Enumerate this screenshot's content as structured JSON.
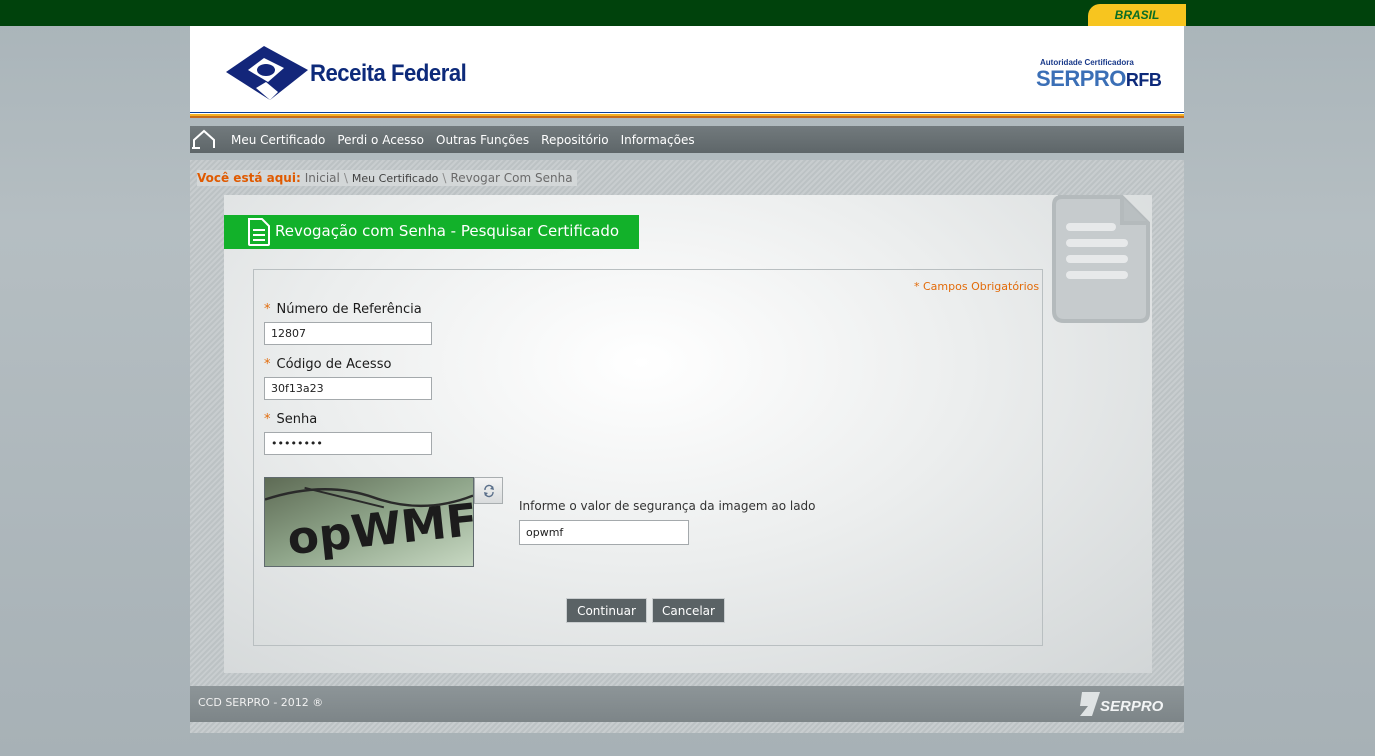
{
  "gov_bar": {
    "brand": "BRASIL"
  },
  "header": {
    "logo_text": "Receita Federal",
    "authority_small": "Autoridade Certificadora",
    "authority_brand": "SERPRO",
    "authority_suffix": "RFB"
  },
  "nav": {
    "items": [
      {
        "label": "Meu Certificado"
      },
      {
        "label": "Perdi o Acesso"
      },
      {
        "label": "Outras Funções"
      },
      {
        "label": "Repositório"
      },
      {
        "label": "Informações"
      }
    ]
  },
  "breadcrumb": {
    "label": "Você está aqui:",
    "items": [
      "Inicial",
      "Meu Certificado",
      "Revogar Com Senha"
    ],
    "separator": "\\"
  },
  "page": {
    "title": "Revogação com Senha - Pesquisar Certificado",
    "required_note": "* Campos Obrigatórios"
  },
  "form": {
    "required_mark": "*",
    "reference": {
      "label": "Número de Referência",
      "value": "12807"
    },
    "access_code": {
      "label": "Código de Acesso",
      "value": "30f13a23"
    },
    "password": {
      "label": "Senha",
      "value": "password"
    },
    "captcha": {
      "image_text": "opWMF",
      "label": "Informe o valor de segurança da imagem ao lado",
      "value": "opwmf"
    },
    "continue_label": "Continuar",
    "cancel_label": "Cancelar"
  },
  "footer": {
    "copyright": "CCD SERPRO - 2012 ®",
    "brand": "SERPRO"
  },
  "colors": {
    "gov_green": "#00420c",
    "brasil_yellow": "#f7c51f",
    "title_green": "#12b12a",
    "accent_orange": "#e26b0a",
    "nav_gray": "#6a7275"
  }
}
